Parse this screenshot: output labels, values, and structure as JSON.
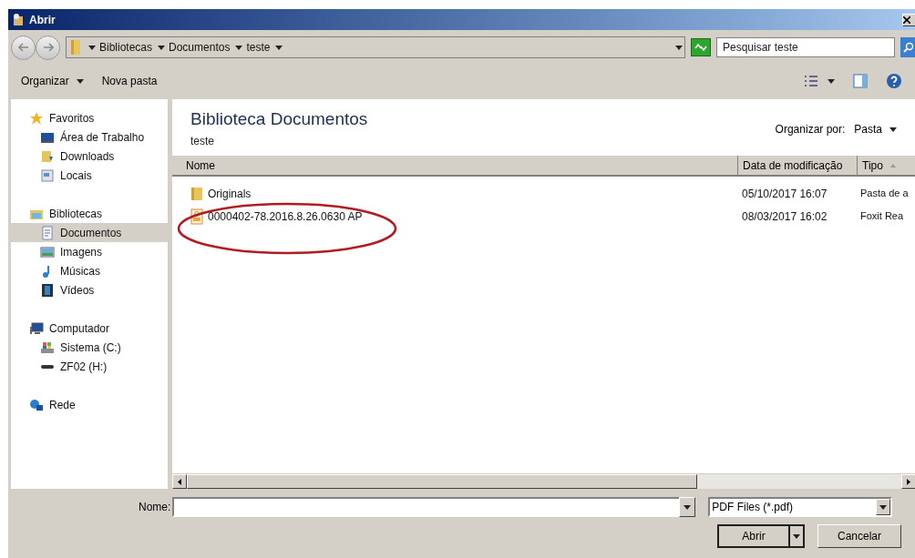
{
  "window": {
    "title": "Abrir"
  },
  "breadcrumb": [
    "Bibliotecas",
    "Documentos",
    "teste"
  ],
  "search": {
    "placeholder": "Pesquisar teste"
  },
  "toolbar": {
    "organize": "Organizar",
    "new_folder": "Nova pasta"
  },
  "sidebar": {
    "groups": [
      {
        "label": "Favoritos",
        "selected": false,
        "children": [
          {
            "label": "Área de Trabalho",
            "selected": false
          },
          {
            "label": "Downloads",
            "selected": false
          },
          {
            "label": "Locais",
            "selected": false
          }
        ]
      },
      {
        "label": "Bibliotecas",
        "selected": false,
        "children": [
          {
            "label": "Documentos",
            "selected": true
          },
          {
            "label": "Imagens",
            "selected": false
          },
          {
            "label": "Músicas",
            "selected": false
          },
          {
            "label": "Vídeos",
            "selected": false
          }
        ]
      },
      {
        "label": "Computador",
        "selected": false,
        "children": [
          {
            "label": "Sistema (C:)",
            "selected": false
          },
          {
            "label": "ZF02 (H:)",
            "selected": false
          }
        ]
      },
      {
        "label": "Rede",
        "selected": false
      }
    ]
  },
  "library": {
    "title": "Biblioteca Documentos",
    "subtitle": "teste",
    "arrange_label": "Organizar por:",
    "arrange_value": "Pasta"
  },
  "table": {
    "columns": [
      {
        "label": "Nome",
        "sorted": false
      },
      {
        "label": "Data de modificação",
        "sorted": false
      },
      {
        "label": "Tipo",
        "sorted": true
      }
    ],
    "rows": [
      {
        "kind": "folder",
        "name": "Originals",
        "date": "05/10/2017 16:07",
        "type": "Pasta de a"
      },
      {
        "kind": "pdf",
        "name": "0000402-78.2016.8.26.0630 AP",
        "date": "08/03/2017 16:02",
        "type": "Foxit Rea"
      }
    ]
  },
  "annotation": {
    "kind": "ellipse",
    "color": "#b01c22"
  },
  "footer": {
    "name_label": "Nome:",
    "filter": "PDF Files (*.pdf)",
    "open": "Abrir",
    "cancel": "Cancelar"
  }
}
